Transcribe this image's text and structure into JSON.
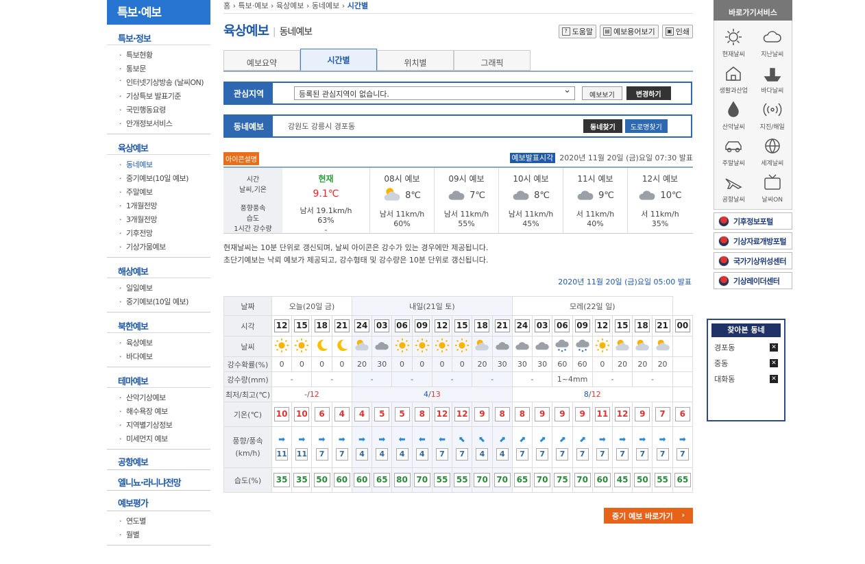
{
  "lnb": {
    "title": "특보·예보",
    "sections": [
      {
        "title": "특보·정보",
        "items": [
          "특보현황",
          "통보문",
          "인터넷기상방송 (날씨ON)",
          "기상특보 발표기준",
          "국민행동요령",
          "안개정보서비스"
        ]
      },
      {
        "title": "육상예보",
        "items": [
          "동네예보",
          "중기예보(10일 예보)",
          "주말예보",
          "1개월전망",
          "3개월전망",
          "기후전망",
          "기상가뭄예보"
        ]
      },
      {
        "title": "해상예보",
        "items": [
          "일일예보",
          "중기예보(10일 예보)"
        ]
      },
      {
        "title": "북한예보",
        "items": [
          "육상예보",
          "바다예보"
        ]
      },
      {
        "title": "테마예보",
        "items": [
          "산악기상예보",
          "해수욕장 예보",
          "지역별기상정보",
          "미세먼지 예보"
        ]
      }
    ],
    "extra": [
      "공항예보",
      "엘니뇨·라니냐전망",
      "예보평가"
    ],
    "eval_items": [
      "연도별",
      "월별"
    ]
  },
  "breadcrumb": [
    "홈",
    "특보·예보",
    "육상예보",
    "동네예보",
    "시간별"
  ],
  "page": {
    "title": "육상예보",
    "sub": "동네예보",
    "sep": "|"
  },
  "top_buttons": [
    "도움말",
    "예보용어보기",
    "인쇄"
  ],
  "tabs": [
    "예보요약",
    "시간별",
    "위치별",
    "그래픽"
  ],
  "interest": {
    "label": "관심지역",
    "select": "등록된 관심지역이 없습니다.",
    "btn_view": "예보보기",
    "btn_change": "변경하기"
  },
  "local": {
    "label": "동네예보",
    "address": "강원도 강릉시 경포동",
    "btn_find": "동네찾기",
    "btn_road": "도로명찾기"
  },
  "icon_help": "아이콘설명",
  "issue": {
    "label": "예보발표시각",
    "time": "2020년 11월 20일 (금)요일 07:30 발표"
  },
  "now_labels": [
    "시간",
    "날씨,기온",
    "풍향풍속",
    "습도",
    "1시간 강수량"
  ],
  "now": {
    "head": "현재",
    "temp": "9.1℃",
    "wind": "남서 19.1km/h",
    "hum": "63%",
    "rain": "-"
  },
  "short": [
    {
      "h": "08시 예보",
      "t": "8℃",
      "wind": "남서 11km/h",
      "hum": "60%",
      "icon": "partly"
    },
    {
      "h": "09시 예보",
      "t": "7℃",
      "wind": "남서 11km/h",
      "hum": "55%",
      "icon": "cloudy"
    },
    {
      "h": "10시 예보",
      "t": "8℃",
      "wind": "남서 11km/h",
      "hum": "45%",
      "icon": "cloudy"
    },
    {
      "h": "11시 예보",
      "t": "9℃",
      "wind": "서 11km/h",
      "hum": "40%",
      "icon": "cloudy"
    },
    {
      "h": "12시 예보",
      "t": "10℃",
      "wind": "서 11km/h",
      "hum": "35%",
      "icon": "cloudy"
    }
  ],
  "notes": [
    "현재날씨는 10분 단위로 갱신되며, 날씨 아이콘은 강수가 있는 경우에만 제공됩니다.",
    "초단기예보는 낙뢰 예보가 제공되고, 강수형태 및 강수량은 10분 단위로 갱신됩니다."
  ],
  "issue2": "2020년 11월 20일 (금)요일 05:00 발표",
  "table": {
    "row_labels": [
      "날짜",
      "시각",
      "날씨",
      "강수확률(%)",
      "강수량(mm)",
      "최저/최고(℃)",
      "기온(℃)",
      "풍향/풍속(km/h)",
      "습도(%)"
    ],
    "days": [
      "오늘(20일 금)",
      "내일(21일 토)",
      "모레(22일 일)"
    ],
    "hours": [
      "12",
      "15",
      "18",
      "21",
      "24",
      "03",
      "06",
      "09",
      "12",
      "15",
      "18",
      "21",
      "24",
      "03",
      "06",
      "09",
      "12",
      "15",
      "18",
      "21",
      "00"
    ],
    "weather": [
      "sun",
      "sun",
      "moon",
      "moon",
      "partly",
      "cloudy",
      "sun",
      "sun",
      "sun",
      "sun",
      "partly",
      "cloudy",
      "cloudy",
      "cloudy",
      "snow",
      "snow",
      "sun",
      "partly",
      "partly",
      "partly"
    ],
    "pop": [
      "0",
      "0",
      "0",
      "0",
      "20",
      "30",
      "0",
      "0",
      "0",
      "0",
      "20",
      "30",
      "30",
      "30",
      "60",
      "60",
      "0",
      "20",
      "20",
      "20"
    ],
    "rain": [
      "-",
      "-",
      "-",
      "-",
      "-",
      "-",
      "-",
      "1~4mm",
      "-",
      "-"
    ],
    "minmax": [
      [
        "-",
        "12"
      ],
      [
        "4",
        "13"
      ],
      [
        "8",
        "12"
      ]
    ],
    "temp": [
      "10",
      "10",
      "6",
      "4",
      "4",
      "5",
      "5",
      "8",
      "12",
      "12",
      "9",
      "8",
      "8",
      "9",
      "9",
      "9",
      "11",
      "12",
      "9",
      "7",
      "6"
    ],
    "wind_dir": [
      "➡",
      "➡",
      "➡",
      "➡",
      "➡",
      "➡",
      "⬅",
      "⬅",
      "⬅",
      "⬉",
      "⬉",
      "⬈",
      "⬈",
      "⬈",
      "⬈",
      "⬈",
      "➡",
      "➡",
      "➡",
      "➡",
      "➡"
    ],
    "wind_speed": [
      "11",
      "11",
      "7",
      "7",
      "4",
      "4",
      "4",
      "4",
      "7",
      "7",
      "4",
      "4",
      "7",
      "7",
      "7",
      "7",
      "7",
      "7",
      "7",
      "7",
      "7"
    ],
    "hum": [
      "35",
      "35",
      "50",
      "60",
      "60",
      "65",
      "80",
      "70",
      "55",
      "55",
      "70",
      "70",
      "65",
      "70",
      "75",
      "70",
      "60",
      "45",
      "50",
      "55",
      "65"
    ]
  },
  "mid_btn": "중기 예보 바로가기",
  "quick": {
    "title": "바로가기서비스",
    "items": [
      "현재날씨",
      "지난날씨",
      "생활과산업",
      "바다날씨",
      "산악날씨",
      "지진/해일",
      "주말날씨",
      "세계날씨",
      "공항날씨",
      "날씨ON"
    ]
  },
  "links": [
    "기후정보포털",
    "기상자료개방포털",
    "국가기상위성센터",
    "기상레이더센터"
  ],
  "recent": {
    "title": "찾아본 동네",
    "items": [
      "경포동",
      "중동",
      "대화동"
    ]
  }
}
